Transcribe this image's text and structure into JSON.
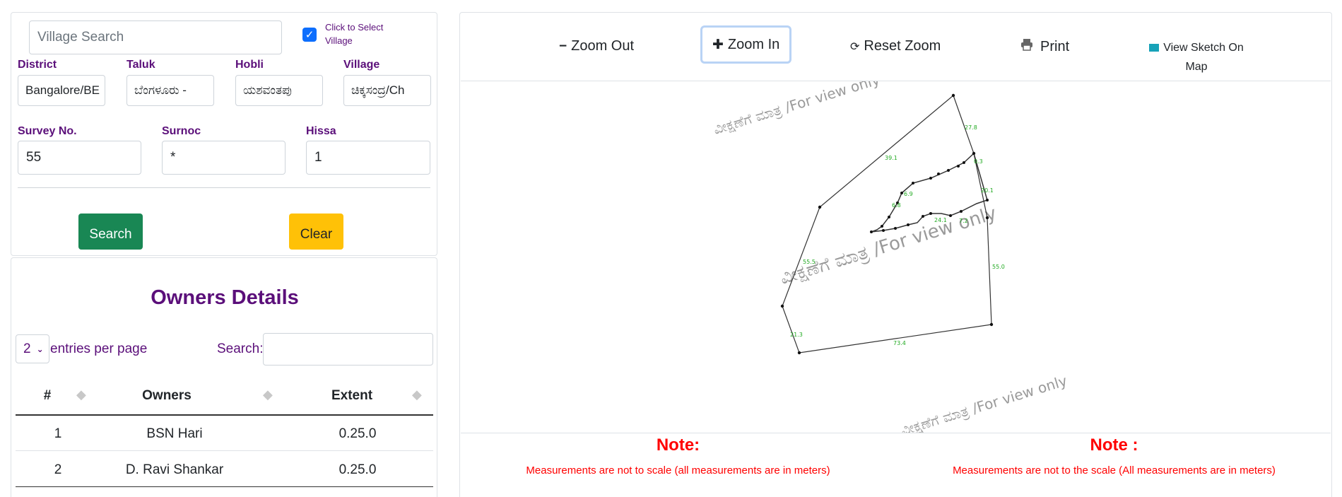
{
  "search": {
    "village_search_placeholder": "Village Search",
    "click_to_select_label": "Click to Select Village",
    "district_label": "District",
    "taluk_label": "Taluk",
    "hobli_label": "Hobli",
    "village_label": "Village",
    "district_value": "Bangalore/BE",
    "taluk_value": "ಬೆಂಗಳೂರು -",
    "hobli_value": "ಯಶವಂತಪು",
    "village_value": "ಚಿಕ್ಕಸಂದ್ರ/Ch",
    "survey_label": "Survey No.",
    "surnoc_label": "Surnoc",
    "hissa_label": "Hissa",
    "survey_value": "55",
    "surnoc_value": "*",
    "hissa_value": "1",
    "search_button": "Search",
    "clear_button": "Clear",
    "colors": {
      "search_btn": "#198754",
      "clear_btn": "#ffc107",
      "label": "#5b0f7a",
      "checkbox": "#0d6efd"
    }
  },
  "owners": {
    "title": "Owners Details",
    "entries_value": "2",
    "entries_label": "entries per page",
    "search_label": "Search:",
    "columns": [
      "#",
      "Owners",
      "Extent"
    ],
    "rows": [
      {
        "num": "1",
        "owner": "BSN Hari",
        "extent": "0.25.0"
      },
      {
        "num": "2",
        "owner": "D. Ravi Shankar",
        "extent": "0.25.0"
      }
    ]
  },
  "map": {
    "toolbar": {
      "zoom_out": "Zoom Out",
      "zoom_in": "Zoom In",
      "reset_zoom": "Reset Zoom",
      "print": "Print",
      "view_sketch": "View Sketch On Map"
    },
    "watermark": "ವೀಕ್ಷಣೆಗೆ ಮಾತ್ರ /For view only",
    "measurements": [
      "27.8",
      "39.1",
      "20.1",
      "55.0",
      "55.5",
      "21.3",
      "73.4",
      "0.3",
      "6.8",
      "6.9",
      "24.1",
      "7.2"
    ],
    "note_left_title": "Note:",
    "note_left_text": "Measurements are not to scale (all measurements are in meters)",
    "note_right_title": "Note :",
    "note_right_text": "Measurements are not to the scale (All measurements are in meters)",
    "colors": {
      "note": "#ff0000",
      "measurement": "#22aa22",
      "line": "#333333",
      "watermark": "#9a9a9a"
    }
  }
}
